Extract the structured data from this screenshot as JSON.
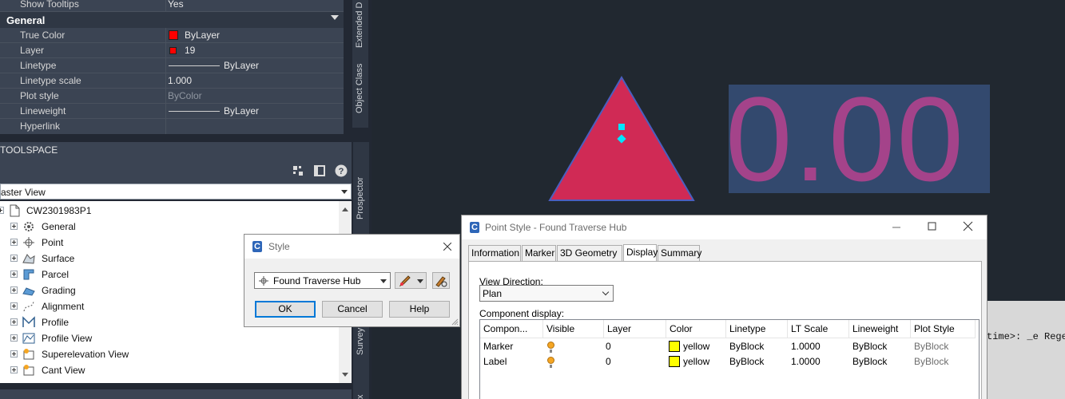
{
  "properties": {
    "rows_top": [
      {
        "key": "Show Tooltips",
        "value": "Yes"
      }
    ],
    "category": "General",
    "rows": [
      {
        "key": "True Color",
        "value": "ByLayer"
      },
      {
        "key": "Layer",
        "value": "19"
      },
      {
        "key": "Linetype",
        "value": "ByLayer"
      },
      {
        "key": "Linetype scale",
        "value": "1.000"
      },
      {
        "key": "Plot style",
        "value": "ByColor"
      },
      {
        "key": "Lineweight",
        "value": "ByLayer"
      },
      {
        "key": "Hyperlink",
        "value": ""
      }
    ],
    "side_tabs": [
      "Extended D",
      "Object Class"
    ]
  },
  "toolspace": {
    "title": "TOOLSPACE",
    "view": "aster View",
    "side_tabs": [
      "Prospector",
      "Survey",
      "x"
    ],
    "tree": {
      "root": "CW2301983P1",
      "items": [
        "General",
        "Point",
        "Surface",
        "Parcel",
        "Grading",
        "Alignment",
        "Profile",
        "Profile View",
        "Superelevation View",
        "Cant View"
      ]
    }
  },
  "drawing": {
    "label_value": "0.00",
    "command_text": "time>: _e Regen",
    "colors": {
      "triangle": "#d02a55",
      "label_text": "#a4438a",
      "label_box": "#33496e",
      "grip": "#00e5ff"
    }
  },
  "style_dialog": {
    "title": "Style",
    "selected_style": "Found Traverse Hub",
    "ok": "OK",
    "cancel": "Cancel",
    "help": "Help"
  },
  "point_style_dialog": {
    "title": "Point Style - Found Traverse Hub",
    "tabs": [
      "Information",
      "Marker",
      "3D Geometry",
      "Display",
      "Summary"
    ],
    "active_tab": "Display",
    "view_direction_label": "View Direction:",
    "view_direction": "Plan",
    "component_display_label": "Component display:",
    "columns": [
      "Compon...",
      "Visible",
      "Layer",
      "Color",
      "Linetype",
      "LT Scale",
      "Lineweight",
      "Plot Style"
    ],
    "rows": [
      {
        "component": "Marker",
        "visible": true,
        "layer": "0",
        "color": "yellow",
        "linetype": "ByBlock",
        "lt_scale": "1.0000",
        "lineweight": "ByBlock",
        "plot_style": "ByBlock"
      },
      {
        "component": "Label",
        "visible": true,
        "layer": "0",
        "color": "yellow",
        "linetype": "ByBlock",
        "lt_scale": "1.0000",
        "lineweight": "ByBlock",
        "plot_style": "ByBlock"
      }
    ]
  }
}
